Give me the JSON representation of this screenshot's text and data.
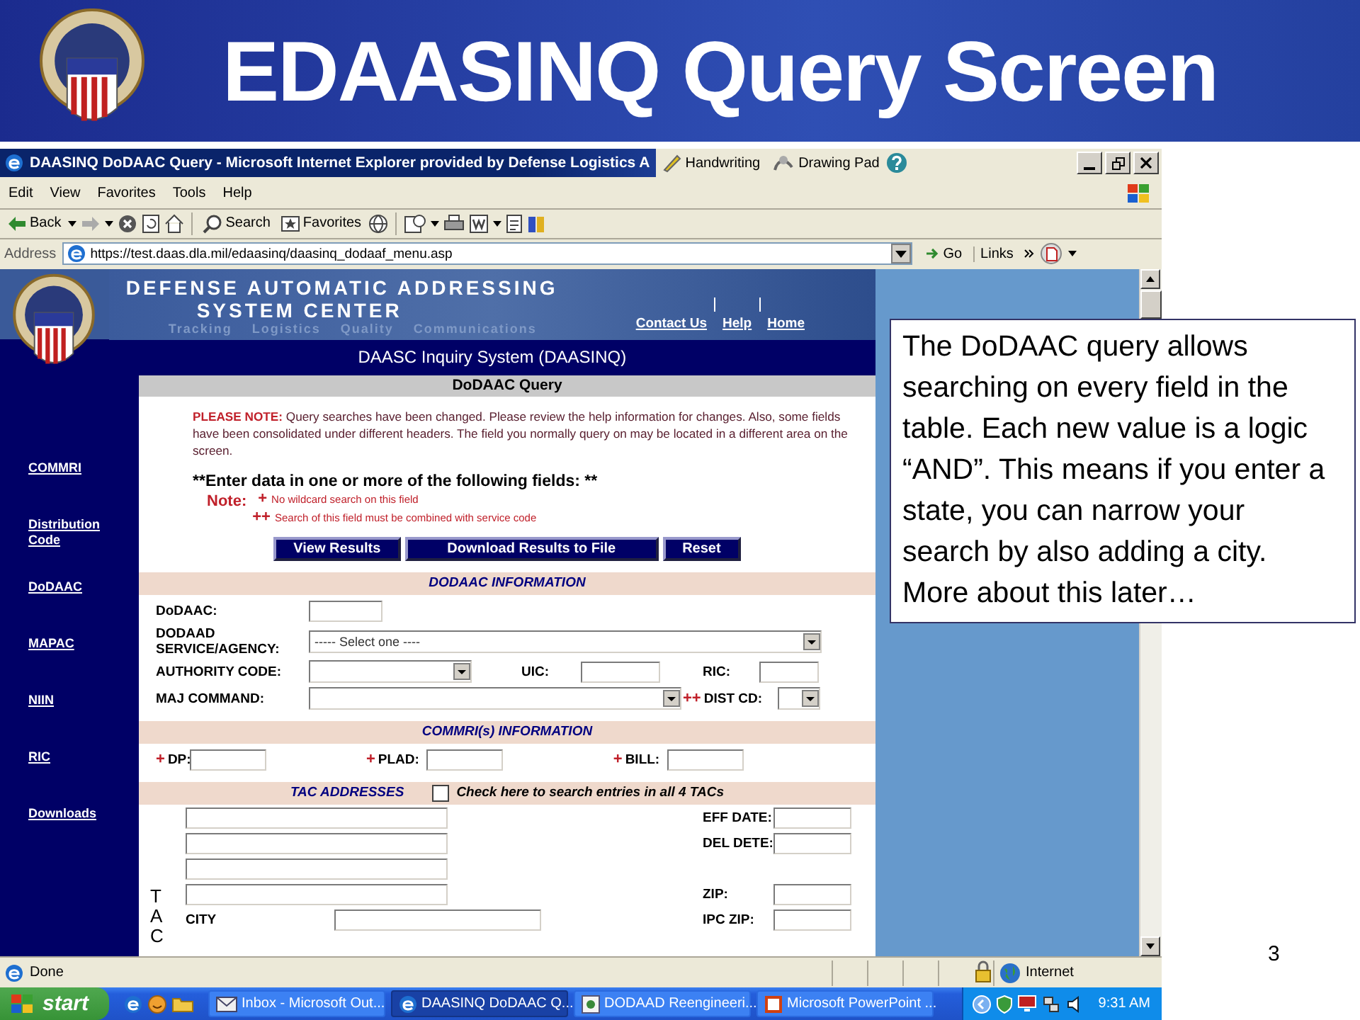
{
  "slide": {
    "title": "EDAASINQ Query Screen",
    "number": "3"
  },
  "browser": {
    "title": "DAASINQ DoDAAC Query - Microsoft Internet Explorer provided by Defense Logistics A",
    "toolbar_buttons": [
      "Handwriting",
      "Drawing Pad"
    ],
    "menu": [
      "Edit",
      "View",
      "Favorites",
      "Tools",
      "Help"
    ],
    "nav_buttons": [
      {
        "label": "Back",
        "kind": "back"
      },
      {
        "label": "Search",
        "kind": "search"
      },
      {
        "label": "Favorites",
        "kind": "favorites"
      }
    ],
    "address_label": "Address",
    "url": "https://test.daas.dla.mil/edaasinq/daasinq_dodaaf_menu.asp",
    "go": "Go",
    "links": "Links",
    "status": "Done",
    "zone": "Internet"
  },
  "site": {
    "banner_title": [
      "DEFENSE AUTOMATIC ADDRESSING",
      "SYSTEM CENTER"
    ],
    "banner_words": [
      "Tracking",
      "Logistics",
      "Quality",
      "Communications"
    ],
    "top_links": [
      "Contact Us",
      "Help",
      "Home"
    ],
    "system_title": "DAASC Inquiry System (DAASINQ)",
    "sidebar": [
      "COMMRI",
      "Distribution Code",
      "DoDAAC",
      "MAPAC",
      "NIIN",
      "RIC",
      "Downloads"
    ]
  },
  "form": {
    "title": "DoDAAC Query",
    "note": "**PLEASE NOTE:**  Query searches have been changed. Please review the help information for changes. Also, some fields have been consolidated under different headers. The field you normally query on may be located in a different area on the screen.",
    "instruction": "**Enter data in one or more of the following fields: **",
    "legend_label": "Note:",
    "legend": [
      {
        "mark": "+",
        "text": "No wildcard search on this field"
      },
      {
        "mark": "++",
        "text": "Search of this field must be combined with service code"
      }
    ],
    "actions": [
      "View Results",
      "Download Results to File",
      "Reset"
    ],
    "sections": [
      {
        "kind": "fields",
        "heading": "DODAAC INFORMATION",
        "fields": [
          {
            "label": "DoDAAC:",
            "kind": "text"
          },
          {
            "label": "DODAAD SERVICE/AGENCY:",
            "kind": "select",
            "value": "----- Select one ----"
          },
          {
            "label": "AUTHORITY CODE:",
            "kind": "select"
          },
          {
            "label": "UIC:",
            "kind": "text"
          },
          {
            "label": "RIC:",
            "kind": "text"
          },
          {
            "label": "MAJ COMMAND:",
            "kind": "select"
          },
          {
            "label": "DIST CD:",
            "kind": "select",
            "mark": "++"
          }
        ]
      },
      {
        "kind": "fields",
        "heading": "COMMRI(s) INFORMATION",
        "fields": [
          {
            "label": "DP:",
            "kind": "text",
            "mark": "+"
          },
          {
            "label": "PLAD:",
            "kind": "text",
            "mark": "+"
          },
          {
            "label": "BILL:",
            "kind": "text",
            "mark": "+"
          }
        ]
      },
      {
        "kind": "tac",
        "heading": "TAC ADDRESSES",
        "checkbox": {
          "label": "Check here to search entries in all 4 TACs",
          "checked": false
        },
        "side_label": "TAC",
        "city": {
          "label": "CITY",
          "kind": "text"
        },
        "right_fields": [
          {
            "label": "EFF DATE:",
            "kind": "text"
          },
          {
            "label": "DEL DETE:",
            "kind": "text"
          },
          {
            "label": "ZIP:",
            "kind": "text"
          },
          {
            "label": "IPC ZIP:",
            "kind": "text"
          }
        ]
      }
    ]
  },
  "callout": "The DoDAAC query allows searching on every field in the table.  Each new value is a logic “AND”.  This means if you enter a state, you can narrow your search by also adding a city.  More about this later…",
  "taskbar": {
    "start": "start",
    "tasks": [
      {
        "label": "Inbox - Microsoft Out...",
        "selected": false
      },
      {
        "label": "DAASINQ DoDAAC Q...",
        "selected": true
      },
      {
        "label": "DODAAD Reengineeri...",
        "selected": false
      },
      {
        "label": "Microsoft PowerPoint ...",
        "selected": false
      }
    ],
    "clock": "9:31 AM"
  }
}
